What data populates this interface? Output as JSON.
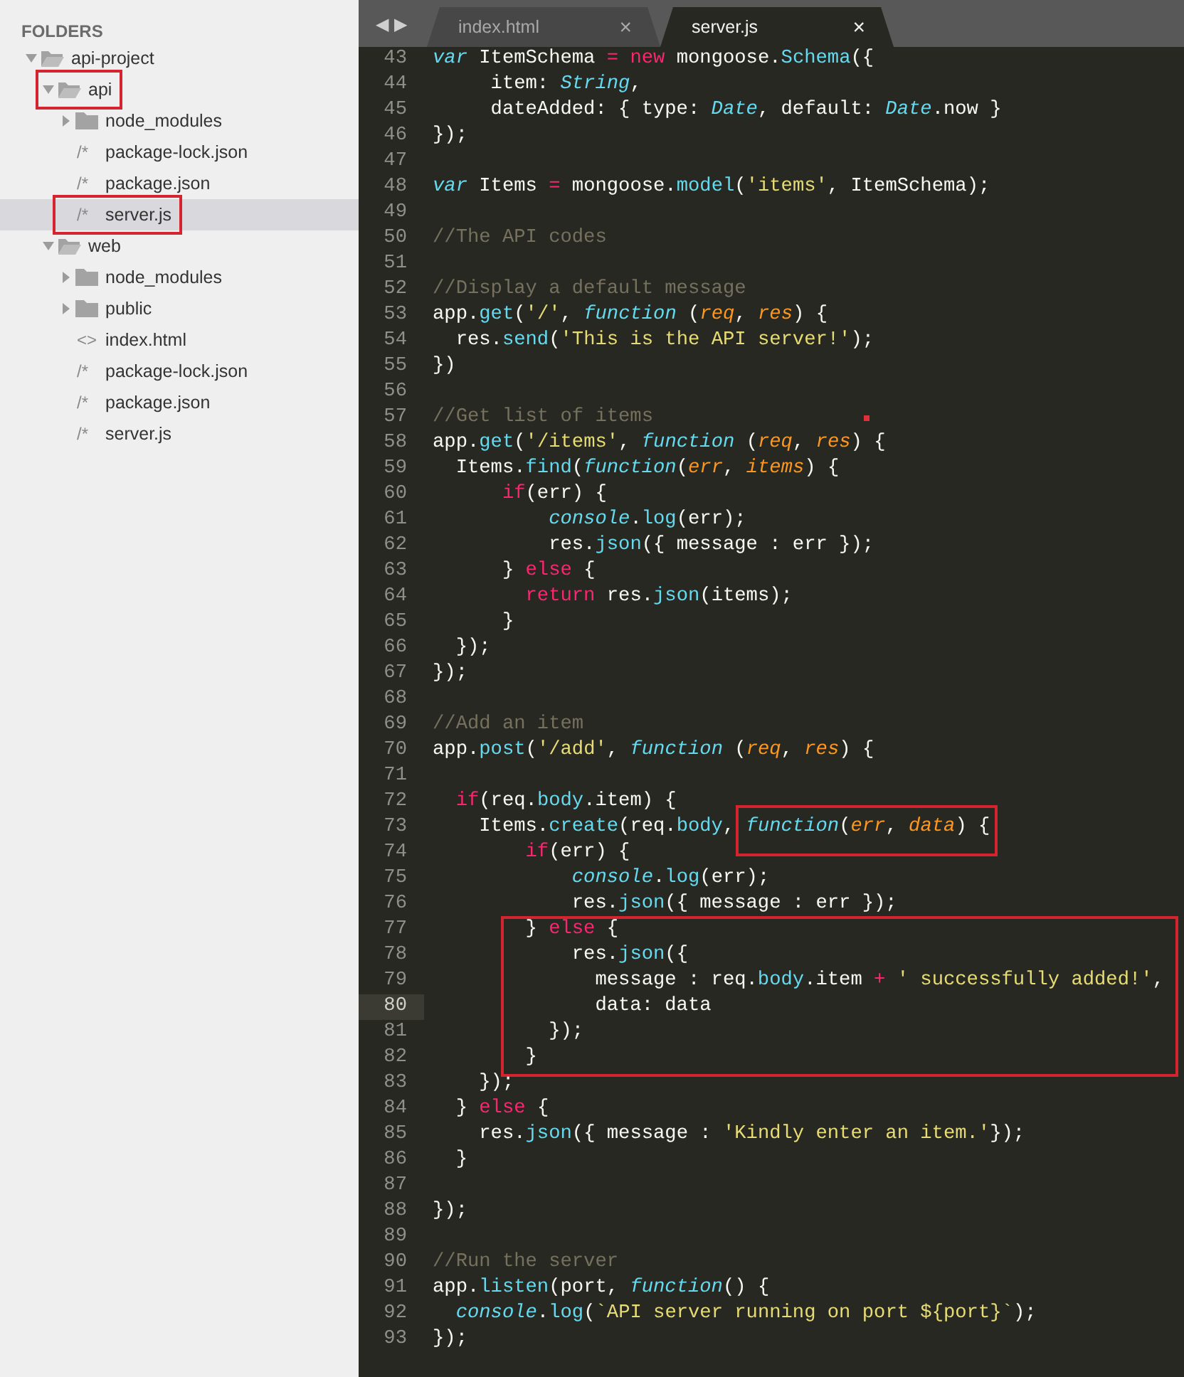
{
  "sidebar": {
    "header": "FOLDERS",
    "tree": [
      {
        "name": "api-project",
        "kind": "folder",
        "expanded": true,
        "selected": false,
        "highlighted": false,
        "children": [
          {
            "name": "api",
            "kind": "folder",
            "expanded": true,
            "selected": false,
            "highlighted": true,
            "children": [
              {
                "name": "node_modules",
                "kind": "folder",
                "expanded": false,
                "selected": false,
                "highlighted": false
              },
              {
                "name": "package-lock.json",
                "kind": "file",
                "glyph": "/*",
                "selected": false,
                "highlighted": false
              },
              {
                "name": "package.json",
                "kind": "file",
                "glyph": "/*",
                "selected": false,
                "highlighted": false
              },
              {
                "name": "server.js",
                "kind": "file",
                "glyph": "/*",
                "selected": true,
                "highlighted": true
              }
            ]
          },
          {
            "name": "web",
            "kind": "folder",
            "expanded": true,
            "selected": false,
            "highlighted": false,
            "children": [
              {
                "name": "node_modules",
                "kind": "folder",
                "expanded": false,
                "selected": false,
                "highlighted": false
              },
              {
                "name": "public",
                "kind": "folder",
                "expanded": false,
                "selected": false,
                "highlighted": false
              },
              {
                "name": "index.html",
                "kind": "file",
                "glyph": "<>",
                "selected": false,
                "highlighted": false
              },
              {
                "name": "package-lock.json",
                "kind": "file",
                "glyph": "/*",
                "selected": false,
                "highlighted": false
              },
              {
                "name": "package.json",
                "kind": "file",
                "glyph": "/*",
                "selected": false,
                "highlighted": false
              },
              {
                "name": "server.js",
                "kind": "file",
                "glyph": "/*",
                "selected": false,
                "highlighted": false
              }
            ]
          }
        ]
      }
    ]
  },
  "tab_bar": {
    "nav": [
      "◀",
      "▶"
    ],
    "tabs": [
      {
        "label": "index.html",
        "close": "×",
        "selected": false
      },
      {
        "label": "server.js",
        "close": "×",
        "selected": true
      }
    ]
  },
  "editor": {
    "lines": [
      {
        "kind": "line",
        "number": "43",
        "current": false,
        "segments": [
          {
            "kind": "storage",
            "text": "var"
          },
          {
            "kind": "plain",
            "text": " ItemSchema "
          },
          {
            "kind": "keyword",
            "text": "= "
          },
          {
            "kind": "keyword",
            "text": "new"
          },
          {
            "kind": "plain",
            "text": " mongoose."
          },
          {
            "kind": "support",
            "text": "Schema"
          },
          {
            "kind": "plain",
            "text": "({"
          }
        ]
      },
      {
        "kind": "line",
        "number": "44",
        "current": false,
        "segments": [
          {
            "kind": "plain",
            "text": "     item: "
          },
          {
            "kind": "storage",
            "text": "String"
          },
          {
            "kind": "plain",
            "text": ","
          }
        ]
      },
      {
        "kind": "line",
        "number": "45",
        "current": false,
        "segments": [
          {
            "kind": "plain",
            "text": "     dateAdded: { type: "
          },
          {
            "kind": "storage",
            "text": "Date"
          },
          {
            "kind": "plain",
            "text": ", default: "
          },
          {
            "kind": "storage",
            "text": "Date"
          },
          {
            "kind": "plain",
            "text": ".now }"
          }
        ]
      },
      {
        "kind": "line",
        "number": "46",
        "current": false,
        "segments": [
          {
            "kind": "plain",
            "text": "});"
          }
        ]
      },
      {
        "kind": "line",
        "number": "47",
        "current": false
      },
      {
        "kind": "line",
        "number": "48",
        "current": false,
        "segments": [
          {
            "kind": "storage",
            "text": "var"
          },
          {
            "kind": "plain",
            "text": " Items "
          },
          {
            "kind": "keyword",
            "text": "="
          },
          {
            "kind": "plain",
            "text": " mongoose."
          },
          {
            "kind": "support",
            "text": "model"
          },
          {
            "kind": "plain",
            "text": "("
          },
          {
            "kind": "string",
            "text": "'items'"
          },
          {
            "kind": "plain",
            "text": ", ItemSchema);"
          }
        ]
      },
      {
        "kind": "line",
        "number": "49",
        "current": false
      },
      {
        "kind": "line",
        "number": "50",
        "current": false,
        "segments": [
          {
            "kind": "comment",
            "text": "//The API codes"
          }
        ]
      },
      {
        "kind": "line",
        "number": "51",
        "current": false
      },
      {
        "kind": "line",
        "number": "52",
        "current": false,
        "segments": [
          {
            "kind": "comment",
            "text": "//Display a default message"
          }
        ]
      },
      {
        "kind": "line",
        "number": "53",
        "current": false,
        "segments": [
          {
            "kind": "plain",
            "text": "app."
          },
          {
            "kind": "support",
            "text": "get"
          },
          {
            "kind": "plain",
            "text": "("
          },
          {
            "kind": "string",
            "text": "'/'"
          },
          {
            "kind": "plain",
            "text": ", "
          },
          {
            "kind": "storage",
            "text": "function"
          },
          {
            "kind": "plain",
            "text": " ("
          },
          {
            "kind": "param",
            "text": "req"
          },
          {
            "kind": "plain",
            "text": ", "
          },
          {
            "kind": "param",
            "text": "res"
          },
          {
            "kind": "plain",
            "text": ") {"
          }
        ]
      },
      {
        "kind": "line",
        "number": "54",
        "current": false,
        "segments": [
          {
            "kind": "plain",
            "text": "  res."
          },
          {
            "kind": "support",
            "text": "send"
          },
          {
            "kind": "plain",
            "text": "("
          },
          {
            "kind": "string",
            "text": "'This is the API server!'"
          },
          {
            "kind": "plain",
            "text": ");"
          }
        ]
      },
      {
        "kind": "line",
        "number": "55",
        "current": false,
        "segments": [
          {
            "kind": "plain",
            "text": "})"
          }
        ]
      },
      {
        "kind": "line",
        "number": "56",
        "current": false
      },
      {
        "kind": "line",
        "number": "57",
        "current": false,
        "segments": [
          {
            "kind": "comment",
            "text": "//Get list of items"
          }
        ]
      },
      {
        "kind": "line",
        "number": "58",
        "current": false,
        "segments": [
          {
            "kind": "plain",
            "text": "app."
          },
          {
            "kind": "support",
            "text": "get"
          },
          {
            "kind": "plain",
            "text": "("
          },
          {
            "kind": "string",
            "text": "'/items'"
          },
          {
            "kind": "plain",
            "text": ", "
          },
          {
            "kind": "storage",
            "text": "function"
          },
          {
            "kind": "plain",
            "text": " ("
          },
          {
            "kind": "param",
            "text": "req"
          },
          {
            "kind": "plain",
            "text": ", "
          },
          {
            "kind": "param",
            "text": "res"
          },
          {
            "kind": "plain",
            "text": ") {"
          }
        ]
      },
      {
        "kind": "line",
        "number": "59",
        "current": false,
        "segments": [
          {
            "kind": "plain",
            "text": "  Items."
          },
          {
            "kind": "support",
            "text": "find"
          },
          {
            "kind": "plain",
            "text": "("
          },
          {
            "kind": "storage",
            "text": "function"
          },
          {
            "kind": "plain",
            "text": "("
          },
          {
            "kind": "param",
            "text": "err"
          },
          {
            "kind": "plain",
            "text": ", "
          },
          {
            "kind": "param",
            "text": "items"
          },
          {
            "kind": "plain",
            "text": ") {"
          }
        ]
      },
      {
        "kind": "line",
        "number": "60",
        "current": false,
        "segments": [
          {
            "kind": "keyword",
            "text": "      if"
          },
          {
            "kind": "plain",
            "text": "(err) {"
          }
        ]
      },
      {
        "kind": "line",
        "number": "61",
        "current": false,
        "segments": [
          {
            "kind": "storage",
            "text": "          console"
          },
          {
            "kind": "plain",
            "text": "."
          },
          {
            "kind": "support",
            "text": "log"
          },
          {
            "kind": "plain",
            "text": "(err);"
          }
        ]
      },
      {
        "kind": "line",
        "number": "62",
        "current": false,
        "segments": [
          {
            "kind": "plain",
            "text": "          res."
          },
          {
            "kind": "support",
            "text": "json"
          },
          {
            "kind": "plain",
            "text": "({ message : err });"
          }
        ]
      },
      {
        "kind": "line",
        "number": "63",
        "current": false,
        "segments": [
          {
            "kind": "plain",
            "text": "      } "
          },
          {
            "kind": "keyword",
            "text": "else"
          },
          {
            "kind": "plain",
            "text": " {"
          }
        ]
      },
      {
        "kind": "line",
        "number": "64",
        "current": false,
        "segments": [
          {
            "kind": "keyword",
            "text": "        return"
          },
          {
            "kind": "plain",
            "text": " res."
          },
          {
            "kind": "support",
            "text": "json"
          },
          {
            "kind": "plain",
            "text": "(items);"
          }
        ]
      },
      {
        "kind": "line",
        "number": "65",
        "current": false,
        "segments": [
          {
            "kind": "plain",
            "text": "      }"
          }
        ]
      },
      {
        "kind": "line",
        "number": "66",
        "current": false,
        "segments": [
          {
            "kind": "plain",
            "text": "  });"
          }
        ]
      },
      {
        "kind": "line",
        "number": "67",
        "current": false,
        "segments": [
          {
            "kind": "plain",
            "text": "});"
          }
        ]
      },
      {
        "kind": "line",
        "number": "68",
        "current": false
      },
      {
        "kind": "line",
        "number": "69",
        "current": false,
        "segments": [
          {
            "kind": "comment",
            "text": "//Add an item"
          }
        ]
      },
      {
        "kind": "line",
        "number": "70",
        "current": false,
        "segments": [
          {
            "kind": "plain",
            "text": "app."
          },
          {
            "kind": "support",
            "text": "post"
          },
          {
            "kind": "plain",
            "text": "("
          },
          {
            "kind": "string",
            "text": "'/add'"
          },
          {
            "kind": "plain",
            "text": ", "
          },
          {
            "kind": "storage",
            "text": "function"
          },
          {
            "kind": "plain",
            "text": " ("
          },
          {
            "kind": "param",
            "text": "req"
          },
          {
            "kind": "plain",
            "text": ", "
          },
          {
            "kind": "param",
            "text": "res"
          },
          {
            "kind": "plain",
            "text": ") {"
          }
        ]
      },
      {
        "kind": "line",
        "number": "71",
        "current": false
      },
      {
        "kind": "line",
        "number": "72",
        "current": false,
        "segments": [
          {
            "kind": "keyword",
            "text": "  if"
          },
          {
            "kind": "plain",
            "text": "(req."
          },
          {
            "kind": "support",
            "text": "body"
          },
          {
            "kind": "plain",
            "text": ".item) {"
          }
        ]
      },
      {
        "kind": "line",
        "number": "73",
        "current": false,
        "segments": [
          {
            "kind": "plain",
            "text": "    Items."
          },
          {
            "kind": "support",
            "text": "create"
          },
          {
            "kind": "plain",
            "text": "(req."
          },
          {
            "kind": "support",
            "text": "body"
          },
          {
            "kind": "plain",
            "text": ", "
          }
        ],
        "boxed_segments": [
          {
            "kind": "storage",
            "text": "function"
          },
          {
            "kind": "plain",
            "text": "("
          },
          {
            "kind": "param",
            "text": "err"
          },
          {
            "kind": "plain",
            "text": ", "
          },
          {
            "kind": "param",
            "text": "data"
          },
          {
            "kind": "plain",
            "text": ") {"
          }
        ]
      },
      {
        "kind": "line",
        "number": "74",
        "current": false,
        "segments": [
          {
            "kind": "keyword",
            "text": "        if"
          },
          {
            "kind": "plain",
            "text": "(err) {"
          }
        ]
      },
      {
        "kind": "line",
        "number": "75",
        "current": false,
        "segments": [
          {
            "kind": "storage",
            "text": "            console"
          },
          {
            "kind": "plain",
            "text": "."
          },
          {
            "kind": "support",
            "text": "log"
          },
          {
            "kind": "plain",
            "text": "(err);"
          }
        ]
      },
      {
        "kind": "line",
        "number": "76",
        "current": false,
        "segments": [
          {
            "kind": "plain",
            "text": "            res."
          },
          {
            "kind": "support",
            "text": "json"
          },
          {
            "kind": "plain",
            "text": "({ message : err });"
          }
        ]
      },
      {
        "kind": "boxed_block",
        "lines": [
          {
            "kind": "line",
            "number": "77",
            "current": false,
            "segments": [
              {
                "kind": "plain",
                "text": "        } "
              },
              {
                "kind": "keyword",
                "text": "else"
              },
              {
                "kind": "plain",
                "text": " {"
              }
            ]
          },
          {
            "kind": "line",
            "number": "78",
            "current": false,
            "segments": [
              {
                "kind": "plain",
                "text": "            res."
              },
              {
                "kind": "support",
                "text": "json"
              },
              {
                "kind": "plain",
                "text": "({"
              }
            ]
          },
          {
            "kind": "line",
            "number": "79",
            "current": false,
            "segments": [
              {
                "kind": "plain",
                "text": "              message : req."
              },
              {
                "kind": "support",
                "text": "body"
              },
              {
                "kind": "plain",
                "text": ".item "
              },
              {
                "kind": "keyword",
                "text": "+ "
              },
              {
                "kind": "string",
                "text": "' successfully added!'"
              },
              {
                "kind": "plain",
                "text": ","
              }
            ]
          },
          {
            "kind": "line",
            "number": "80",
            "current": true,
            "segments": [
              {
                "kind": "plain",
                "text": "              data: data"
              }
            ]
          },
          {
            "kind": "line",
            "number": "81",
            "current": false,
            "segments": [
              {
                "kind": "plain",
                "text": "          });"
              }
            ]
          },
          {
            "kind": "line",
            "number": "82",
            "current": false,
            "segments": [
              {
                "kind": "plain",
                "text": "        }"
              }
            ]
          }
        ]
      },
      {
        "kind": "line",
        "number": "83",
        "current": false,
        "segments": [
          {
            "kind": "plain",
            "text": "    });"
          }
        ]
      },
      {
        "kind": "line",
        "number": "84",
        "current": false,
        "segments": [
          {
            "kind": "plain",
            "text": "  } "
          },
          {
            "kind": "keyword",
            "text": "else"
          },
          {
            "kind": "plain",
            "text": " {"
          }
        ]
      },
      {
        "kind": "line",
        "number": "85",
        "current": false,
        "segments": [
          {
            "kind": "plain",
            "text": "    res."
          },
          {
            "kind": "support",
            "text": "json"
          },
          {
            "kind": "plain",
            "text": "({ message : "
          },
          {
            "kind": "string",
            "text": "'Kindly enter an item.'"
          },
          {
            "kind": "plain",
            "text": "});"
          }
        ]
      },
      {
        "kind": "line",
        "number": "86",
        "current": false,
        "segments": [
          {
            "kind": "plain",
            "text": "  }"
          }
        ]
      },
      {
        "kind": "line",
        "number": "87",
        "current": false
      },
      {
        "kind": "line",
        "number": "88",
        "current": false,
        "segments": [
          {
            "kind": "plain",
            "text": "});"
          }
        ]
      },
      {
        "kind": "line",
        "number": "89",
        "current": false
      },
      {
        "kind": "line",
        "number": "90",
        "current": false,
        "segments": [
          {
            "kind": "comment",
            "text": "//Run the server"
          }
        ]
      },
      {
        "kind": "line",
        "number": "91",
        "current": false,
        "segments": [
          {
            "kind": "plain",
            "text": "app."
          },
          {
            "kind": "support",
            "text": "listen"
          },
          {
            "kind": "plain",
            "text": "(port, "
          },
          {
            "kind": "storage",
            "text": "function"
          },
          {
            "kind": "plain",
            "text": "() {"
          }
        ]
      },
      {
        "kind": "line",
        "number": "92",
        "current": false,
        "segments": [
          {
            "kind": "storage",
            "text": "  console"
          },
          {
            "kind": "plain",
            "text": "."
          },
          {
            "kind": "support",
            "text": "log"
          },
          {
            "kind": "plain",
            "text": "("
          },
          {
            "kind": "string",
            "text": "`API server running on port ${port}`"
          },
          {
            "kind": "plain",
            "text": ");"
          }
        ]
      },
      {
        "kind": "line",
        "number": "93",
        "current": false,
        "segments": [
          {
            "kind": "plain",
            "text": "});"
          }
        ]
      }
    ]
  }
}
